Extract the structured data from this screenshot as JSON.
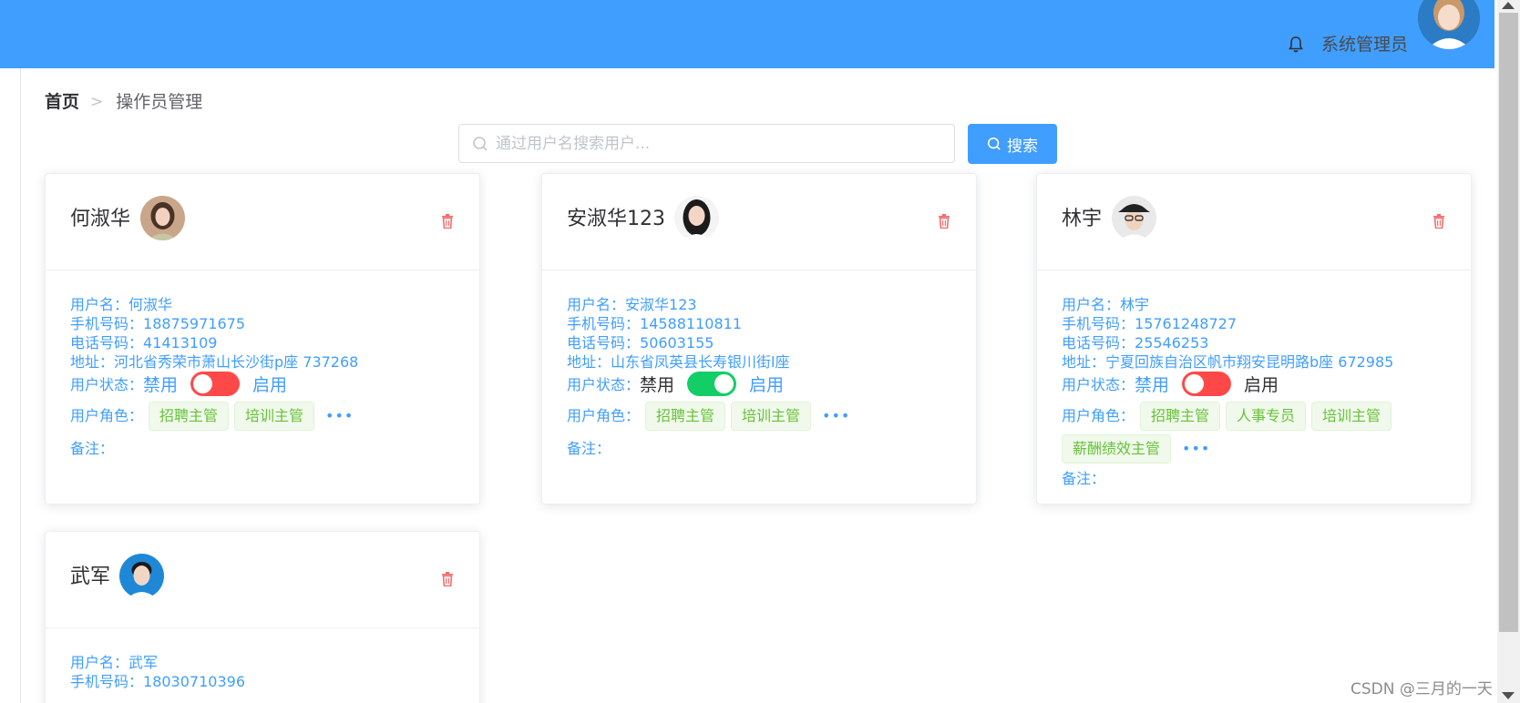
{
  "header": {
    "admin_name": "系统管理员",
    "bg_color": "#409eff",
    "icons": {
      "bell": "bell-icon"
    }
  },
  "breadcrumb": {
    "home": "首页",
    "separator": ">",
    "current": "操作员管理"
  },
  "search": {
    "placeholder": "通过用户名搜索用户...",
    "value": "",
    "button_label": "搜索"
  },
  "card_labels": {
    "username": "用户名：",
    "mobile": "手机号码：",
    "phone": "电话号码：",
    "address": "地址：",
    "status": "用户状态：",
    "status_off": "禁用",
    "status_on": "启用",
    "roles": "用户角色：",
    "more": "•••",
    "notes": "备注："
  },
  "users": [
    {
      "name": "何淑华",
      "username": "何淑华",
      "mobile": "18875971675",
      "phone": "41413109",
      "address": "河北省秀荣市萧山长沙街p座 737268",
      "enabled": false,
      "roles": [
        "招聘主管",
        "培训主管"
      ],
      "notes": ""
    },
    {
      "name": "安淑华123",
      "username": "安淑华123",
      "mobile": "14588110811",
      "phone": "50603155",
      "address": "山东省凤英县长寿银川街l座",
      "enabled": true,
      "roles": [
        "招聘主管",
        "培训主管"
      ],
      "notes": ""
    },
    {
      "name": "林宇",
      "username": "林宇",
      "mobile": "15761248727",
      "phone": "25546253",
      "address": "宁夏回族自治区帆市翔安昆明路b座 672985",
      "enabled": false,
      "roles": [
        "招聘主管",
        "人事专员",
        "培训主管",
        "薪酬绩效主管"
      ],
      "notes": ""
    },
    {
      "name": "武军",
      "username": "武军",
      "mobile": "18030710396"
    }
  ],
  "colors": {
    "switch_on": "#13ce66",
    "switch_off": "#ff4949",
    "accent": "#409eff",
    "tag_text": "#67c23a",
    "delete": "#f56c6c"
  },
  "watermark": "CSDN @三月的一天"
}
